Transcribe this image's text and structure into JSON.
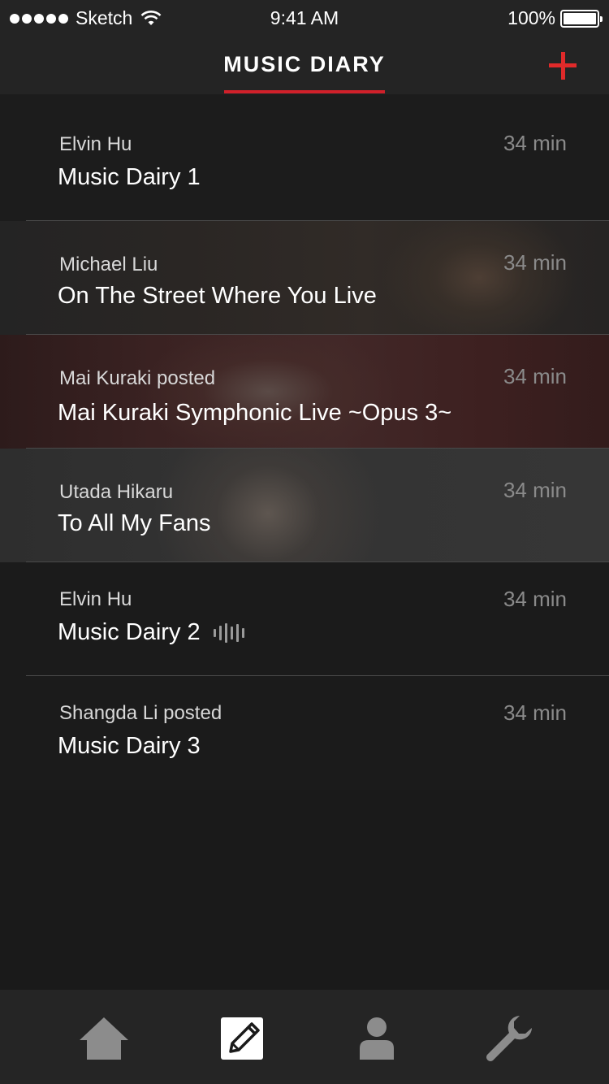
{
  "status_bar": {
    "carrier": "Sketch",
    "time": "9:41 AM",
    "battery": "100%",
    "signal_icon": "signal-dots-icon",
    "wifi_icon": "wifi-icon",
    "battery_icon": "battery-icon"
  },
  "nav": {
    "title": "MUSIC DIARY",
    "add_icon": "plus-icon",
    "accent_color": "#e02a2a"
  },
  "entries": [
    {
      "author": "Elvin Hu",
      "title": "Music Dairy 1",
      "time": "34 min"
    },
    {
      "author": "Michael Liu",
      "title": "On The Street Where You Live",
      "time": "34 min"
    },
    {
      "author": "Mai Kuraki posted",
      "title": "Mai Kuraki Symphonic Live ~Opus 3~",
      "time": "34 min"
    },
    {
      "author": "Utada Hikaru",
      "title": "To All My Fans",
      "time": "34 min"
    },
    {
      "author": "Elvin Hu",
      "title": "Music Dairy 2",
      "time": "34 min",
      "badge_icon": "audio-waveform-icon"
    },
    {
      "author": "Shangda Li posted",
      "title": "Music Dairy 3",
      "time": "34 min"
    }
  ],
  "tabbar": {
    "tabs": [
      {
        "icon": "home-icon",
        "selected": false
      },
      {
        "icon": "edit-diary-icon",
        "selected": true
      },
      {
        "icon": "profile-icon",
        "selected": false
      },
      {
        "icon": "wrench-settings-icon",
        "selected": false
      }
    ]
  }
}
